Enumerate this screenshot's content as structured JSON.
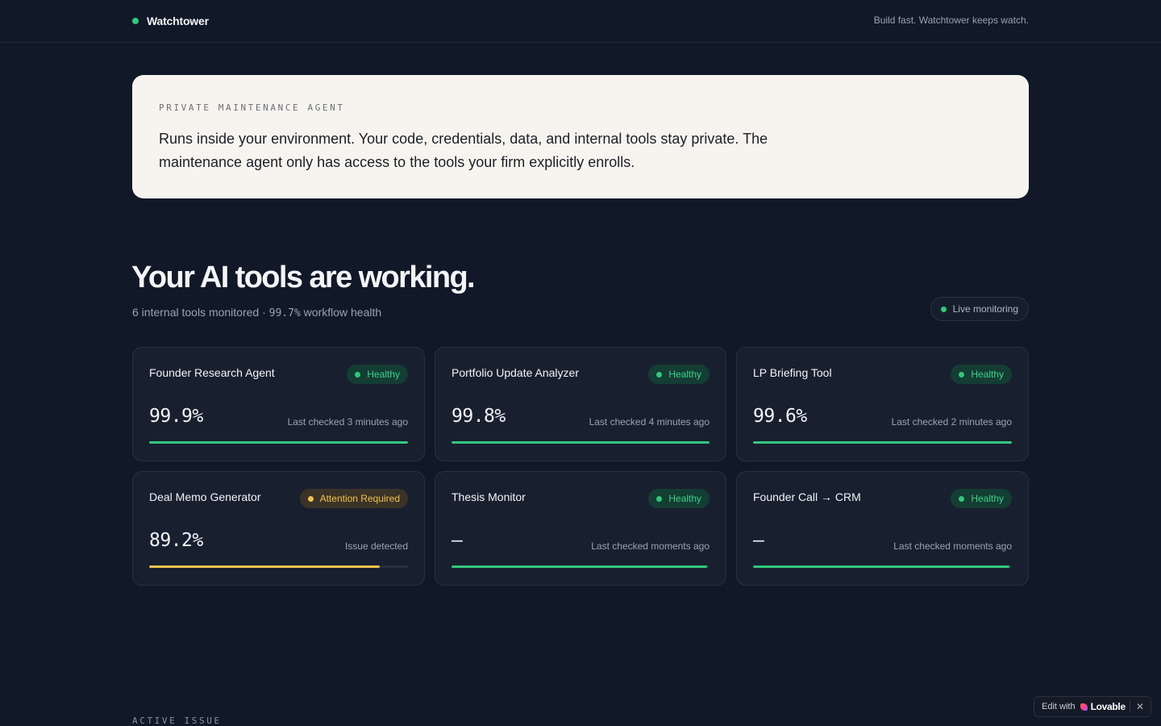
{
  "header": {
    "brand": "Watchtower",
    "tagline": "Build fast. Watchtower keeps watch."
  },
  "notice": {
    "label": "PRIVATE MAINTENANCE AGENT",
    "body": "Runs inside your environment. Your code, credentials, data, and internal tools stay private. The maintenance agent only has access to the tools your firm explicitly enrolls."
  },
  "hero": {
    "title": "Your AI tools are working.",
    "monitored_text": "6 internal tools monitored · ",
    "health_value": "99.7%",
    "health_text": " workflow health",
    "live_label": "Live monitoring"
  },
  "tools": [
    {
      "name": "Founder Research Agent",
      "status": "Healthy",
      "status_type": "healthy",
      "metric": "99.9%",
      "checked": "Last checked 3 minutes ago",
      "progress": 1.0
    },
    {
      "name": "Portfolio Update Analyzer",
      "status": "Healthy",
      "status_type": "healthy",
      "metric": "99.8%",
      "checked": "Last checked 4 minutes ago",
      "progress": 1.0
    },
    {
      "name": "LP Briefing Tool",
      "status": "Healthy",
      "status_type": "healthy",
      "metric": "99.6%",
      "checked": "Last checked 2 minutes ago",
      "progress": 1.0
    },
    {
      "name": "Deal Memo Generator",
      "status": "Attention Required",
      "status_type": "warn",
      "metric": "89.2%",
      "checked": "Issue detected",
      "progress": 0.892
    },
    {
      "name": "Thesis Monitor",
      "status": "Healthy",
      "status_type": "healthy",
      "metric": "–",
      "checked": "Last checked moments ago",
      "progress": 0.99
    },
    {
      "name": "Founder Call → CRM",
      "status": "Healthy",
      "status_type": "healthy",
      "metric": "–",
      "checked": "Last checked moments ago",
      "progress": 0.99
    }
  ],
  "active_issue_label": "ACTIVE ISSUE",
  "edit_chip": {
    "prefix": "Edit with",
    "brand": "Lovable",
    "close": "✕"
  },
  "colors": {
    "background": "#111827",
    "healthy": "#34c77b",
    "warning": "#f2c14e"
  }
}
